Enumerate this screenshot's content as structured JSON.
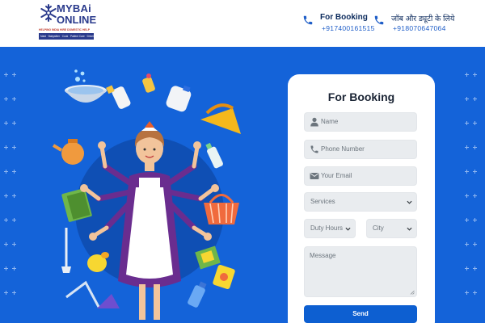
{
  "brand": {
    "line1": "MYBAi",
    "line2": "ONLINE",
    "tagline": "HELPING INDIA HIRE DOMESTIC HELP",
    "services": "Maid · Babysitter · Cook · Patient Care · Driver",
    "primary_color": "#2a3a8c",
    "accent_color": "#c0392b"
  },
  "header": {
    "contacts": [
      {
        "title": "For Booking",
        "number": "+917400161515",
        "icon": "phone-icon"
      },
      {
        "title": "जॉब और ड्यूटी के लिये",
        "number": "+918070647064",
        "icon": "phone-icon"
      }
    ]
  },
  "hero": {
    "background_color": "#1463d9",
    "illustration": "multi-armed-maid-with-household-items"
  },
  "form": {
    "title": "For Booking",
    "name_placeholder": "Name",
    "phone_placeholder": "Phone Number",
    "email_placeholder": "Your Email",
    "services_selected": "Services",
    "duty_hours_selected": "Duty Hours",
    "city_selected": "City",
    "message_placeholder": "Message",
    "send_label": "Send",
    "button_color": "#0d5fd1"
  }
}
